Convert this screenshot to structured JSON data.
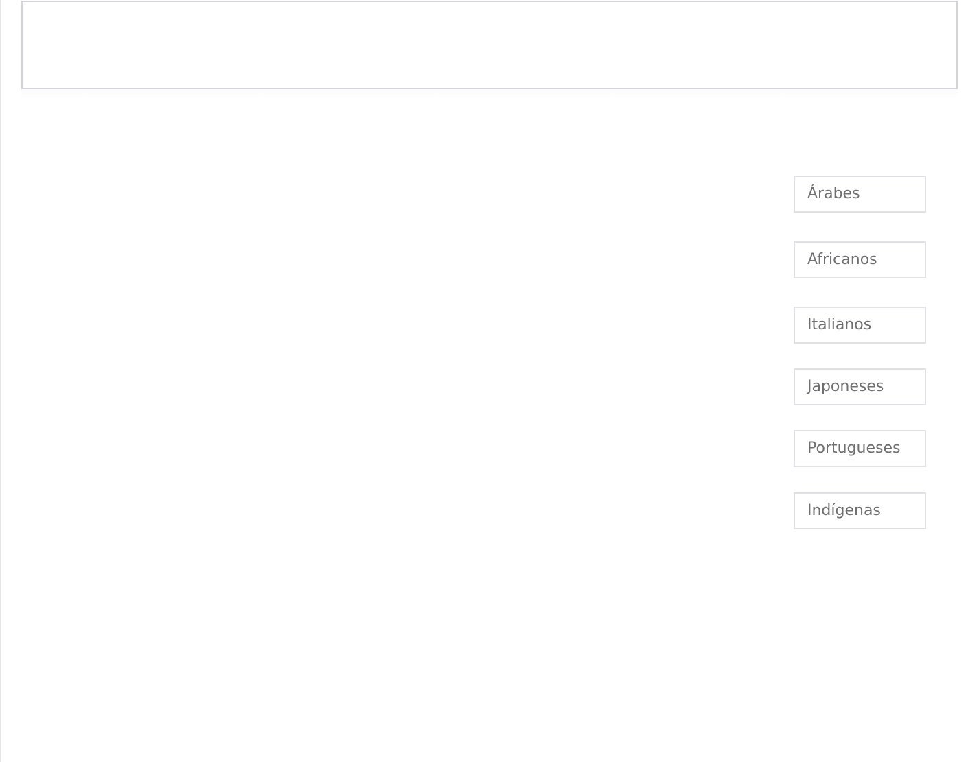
{
  "options": [
    {
      "label": "Árabes"
    },
    {
      "label": "Africanos"
    },
    {
      "label": "Italianos"
    },
    {
      "label": "Japoneses"
    },
    {
      "label": "Portugueses"
    },
    {
      "label": "Indígenas"
    }
  ]
}
